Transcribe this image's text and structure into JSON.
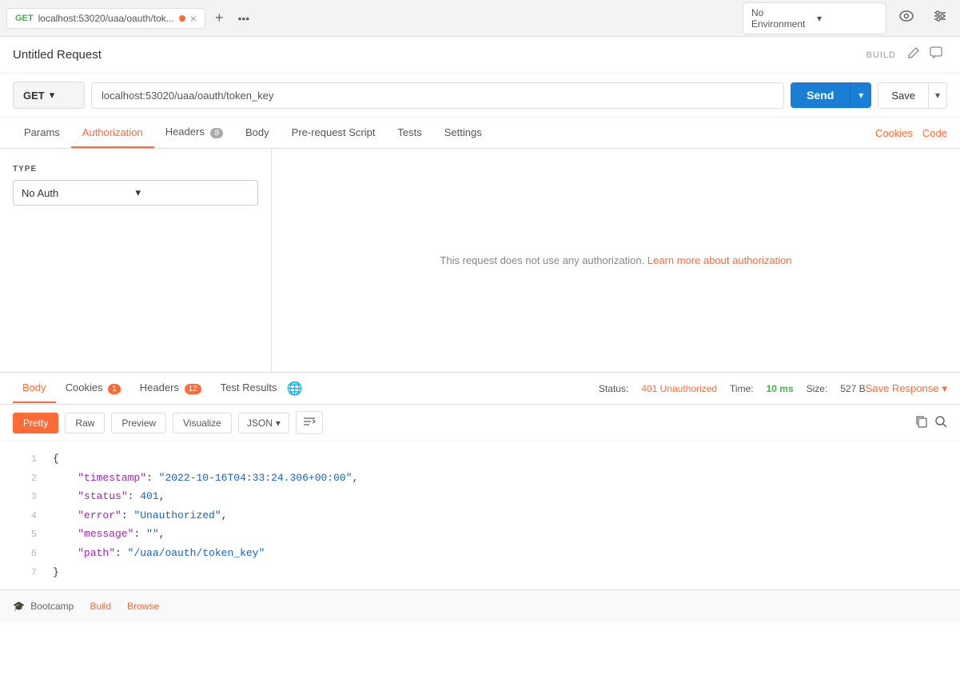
{
  "topbar": {
    "tab": {
      "method": "GET",
      "url_display": "localhost:53020/uaa/oauth/tok...",
      "dot_color": "#FF6B35"
    },
    "add_tab_label": "+",
    "more_label": "•••",
    "env": {
      "selected": "No Environment",
      "placeholder": "No Environment"
    },
    "icons": {
      "eye": "👁",
      "sliders": "⚙"
    }
  },
  "request": {
    "title": "Untitled Request",
    "build_label": "BUILD",
    "method": "GET",
    "url": "localhost:53020/uaa/oauth/token_key",
    "send_label": "Send",
    "save_label": "Save"
  },
  "tabs": {
    "items": [
      {
        "label": "Params",
        "active": false,
        "badge": null
      },
      {
        "label": "Authorization",
        "active": true,
        "badge": null
      },
      {
        "label": "Headers",
        "active": false,
        "badge": "8"
      },
      {
        "label": "Body",
        "active": false,
        "badge": null
      },
      {
        "label": "Pre-request Script",
        "active": false,
        "badge": null
      },
      {
        "label": "Tests",
        "active": false,
        "badge": null
      },
      {
        "label": "Settings",
        "active": false,
        "badge": null
      }
    ],
    "right": {
      "cookies": "Cookies",
      "code": "Code"
    }
  },
  "auth": {
    "type_label": "TYPE",
    "type_value": "No Auth",
    "no_auth_message": "This request does not use any authorization.",
    "learn_more": "Learn more about authorization"
  },
  "response": {
    "tabs": [
      {
        "label": "Body",
        "active": true,
        "badge": null
      },
      {
        "label": "Cookies",
        "active": false,
        "badge": "1"
      },
      {
        "label": "Headers",
        "active": false,
        "badge": "12"
      },
      {
        "label": "Test Results",
        "active": false,
        "badge": null
      }
    ],
    "status_label": "Status:",
    "status_code": "401 Unauthorized",
    "time_label": "Time:",
    "time_value": "10 ms",
    "size_label": "Size:",
    "size_value": "527 B",
    "save_response": "Save Response",
    "view_modes": [
      "Pretty",
      "Raw",
      "Preview",
      "Visualize"
    ],
    "active_view": "Pretty",
    "format": "JSON"
  },
  "json_body": {
    "lines": [
      {
        "num": 1,
        "content": "{",
        "type": "bracket"
      },
      {
        "num": 2,
        "key": "timestamp",
        "value": "\"2022-10-16T04:33:24.306+00:00\"",
        "value_type": "string",
        "comma": true
      },
      {
        "num": 3,
        "key": "status",
        "value": "401",
        "value_type": "number",
        "comma": true
      },
      {
        "num": 4,
        "key": "error",
        "value": "\"Unauthorized\"",
        "value_type": "string",
        "comma": true
      },
      {
        "num": 5,
        "key": "message",
        "value": "\"\"",
        "value_type": "string",
        "comma": true
      },
      {
        "num": 6,
        "key": "path",
        "value": "\"/uaa/oauth/token_key\"",
        "value_type": "string",
        "comma": false
      },
      {
        "num": 7,
        "content": "}",
        "type": "bracket"
      }
    ]
  },
  "bottombar": {
    "bootcamp": "Bootcamp",
    "build": "Build",
    "browse": "Browse"
  }
}
